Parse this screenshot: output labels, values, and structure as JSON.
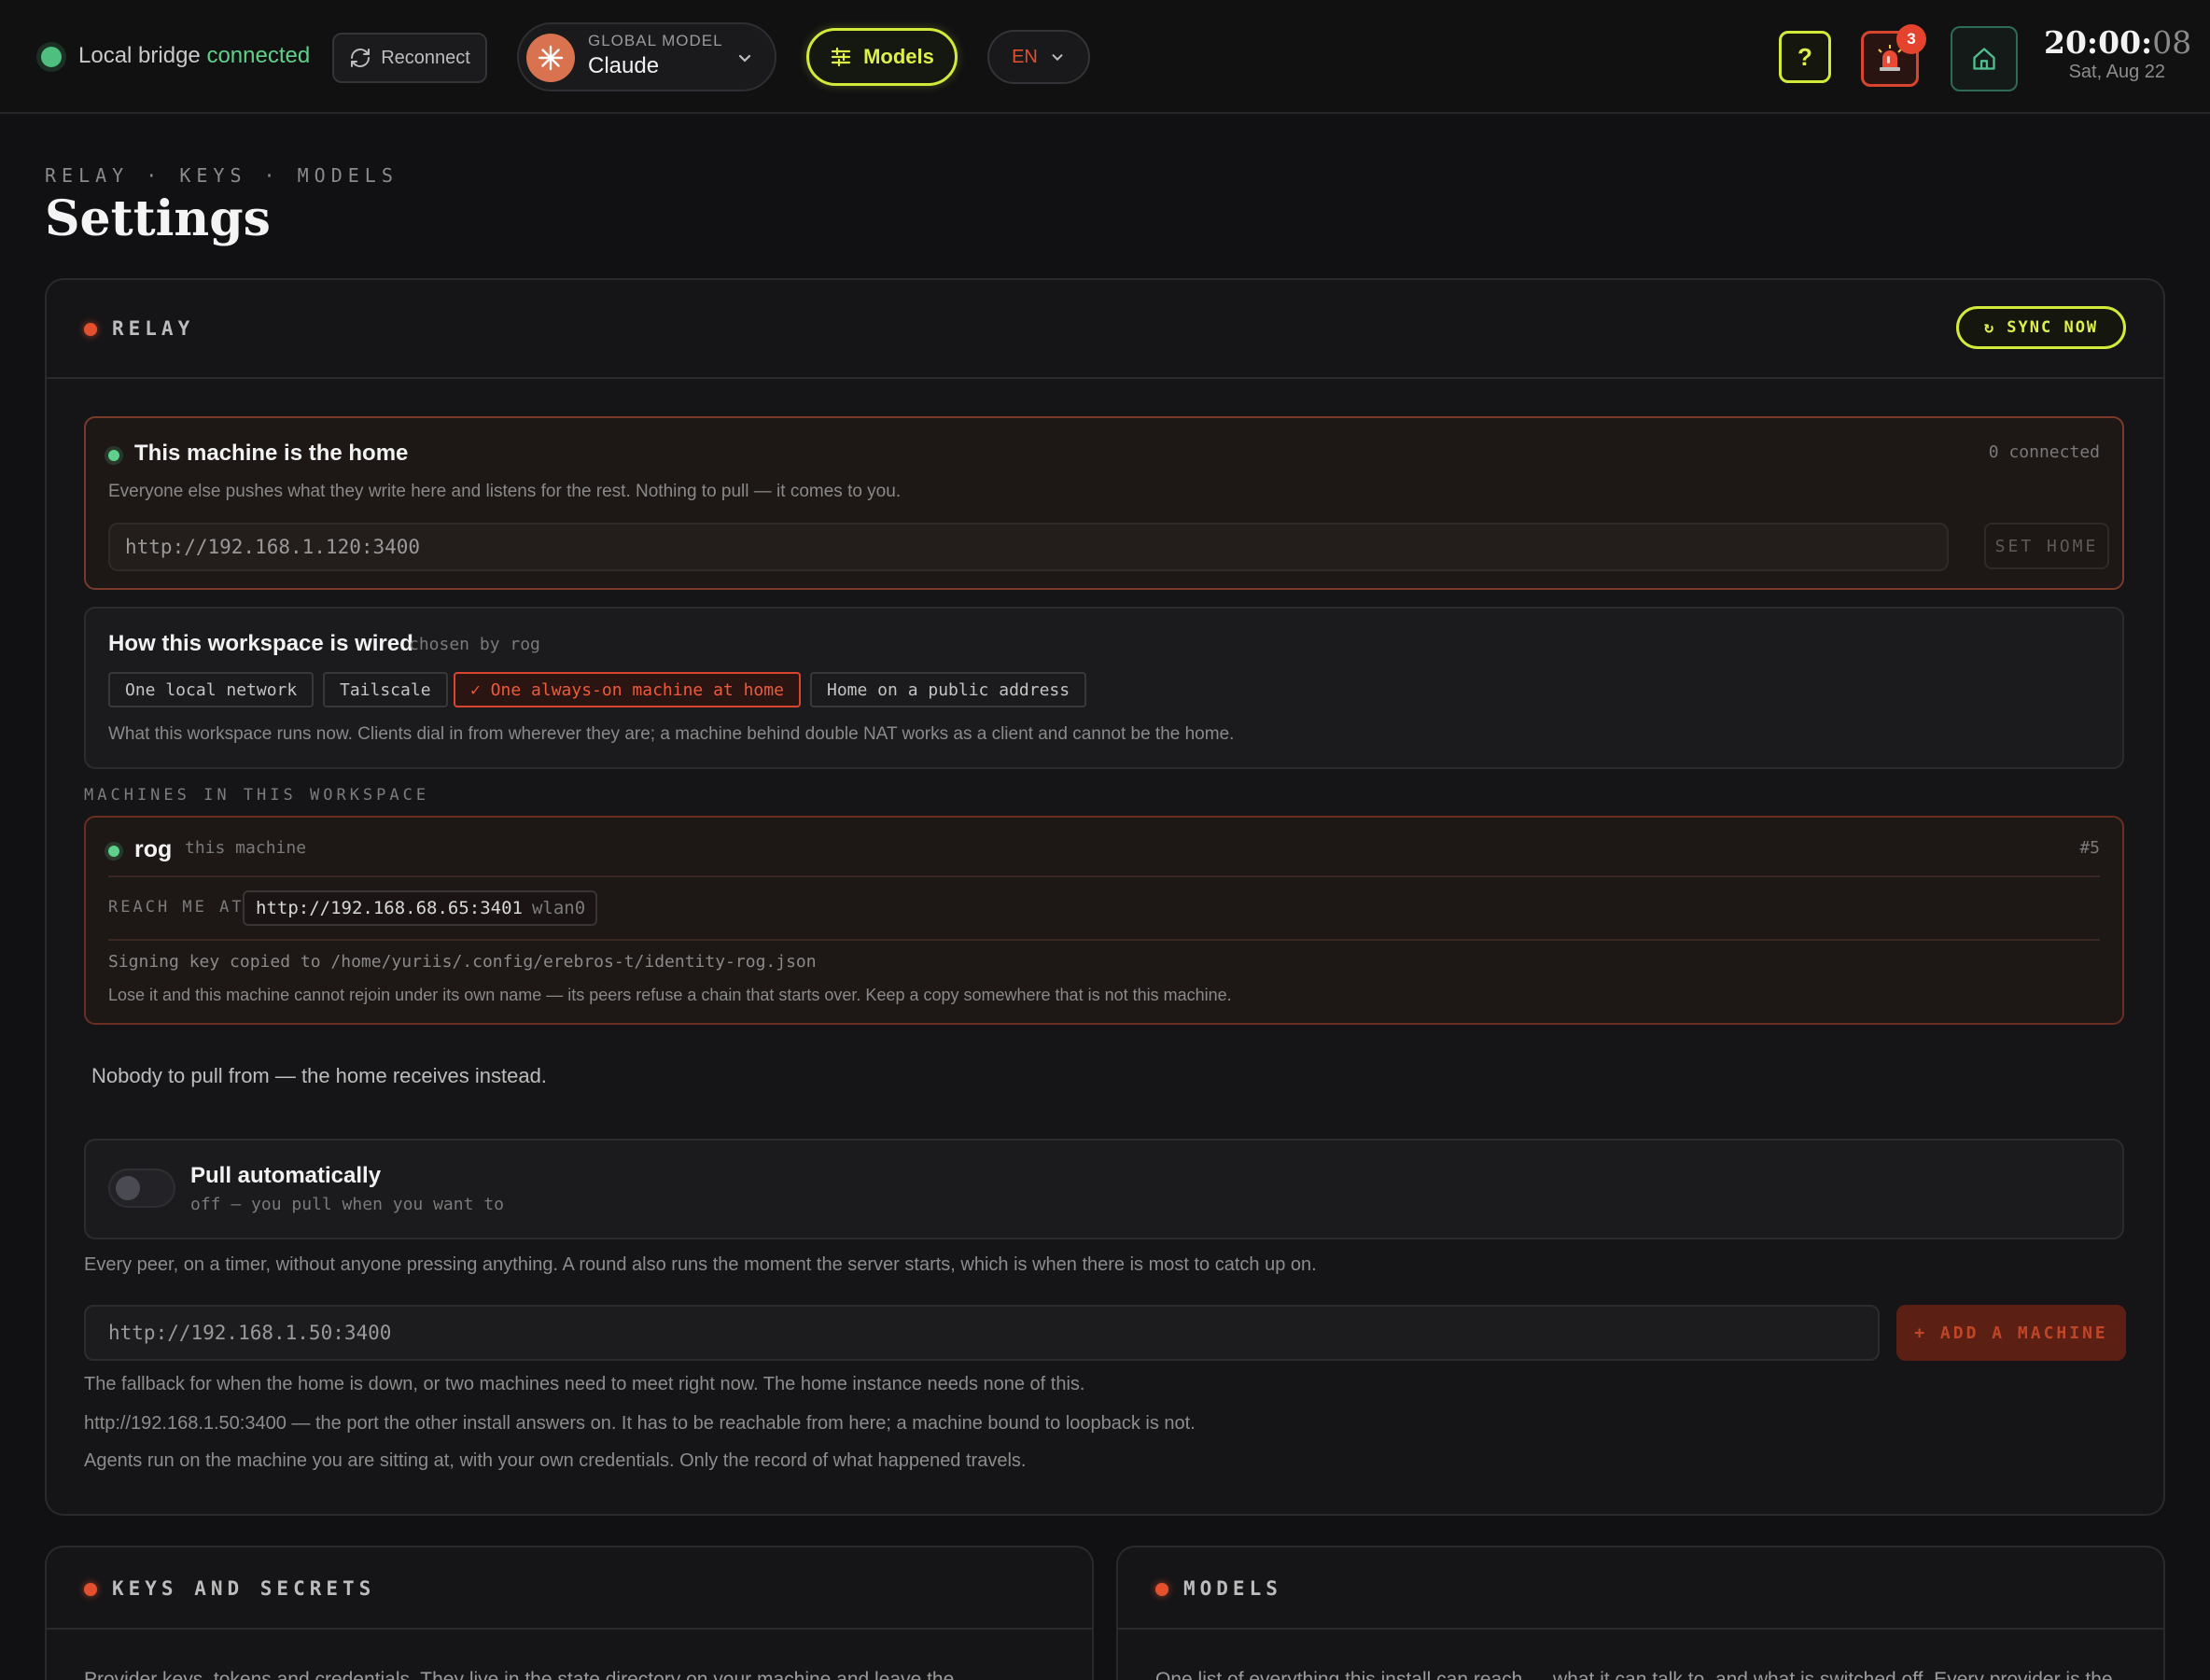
{
  "topbar": {
    "bridge_label": "Local bridge",
    "bridge_status": "connected",
    "reconnect_label": "Reconnect",
    "model_label": "GLOBAL MODEL",
    "model_name": "Claude",
    "models_label": "Models",
    "lang_label": "EN",
    "help_label": "?",
    "alarm_count": "3",
    "clock_hm": "20:00:",
    "clock_s": "08",
    "date": "Sat, Aug 22",
    "colors": {
      "accent": "#d4ea3a",
      "danger": "#e4442d",
      "ok": "#5fd08a"
    }
  },
  "page": {
    "breadcrumb": "RELAY · KEYS · MODELS",
    "title": "Settings"
  },
  "relay": {
    "title": "RELAY",
    "sync_label": "↻ SYNC NOW",
    "home_card": {
      "title": "This machine is the home",
      "connected": "0 connected",
      "description": "Everyone else pushes what they write here and listens for the rest. Nothing to pull — it comes to you.",
      "url_placeholder": "http://192.168.1.120:3400",
      "set_home_label": "SET HOME"
    },
    "wired_card": {
      "title": "How this workspace is wired",
      "chosen_by": "chosen by rog",
      "options": [
        "One local network",
        "Tailscale",
        "✓ One always-on machine at home",
        "Home on a public address"
      ],
      "selected_index": 2,
      "description": "What this workspace runs now. Clients dial in from wherever they are; a machine behind double NAT works as a client and cannot be the home."
    },
    "machines_label": "MACHINES IN THIS WORKSPACE",
    "machine": {
      "name": "rog",
      "tag": "this machine",
      "number": "#5",
      "reach_label": "REACH ME AT",
      "reach_url": "http://192.168.68.65:3401",
      "reach_iface": "wlan0",
      "key_note": "Signing key copied to /home/yuriis/.config/erebros-t/identity-rog.json",
      "key_warning": "Lose it and this machine cannot rejoin under its own name — its peers refuse a chain that starts over. Keep a copy somewhere that is not this machine."
    },
    "nobody_text": "Nobody to pull from — the home receives instead.",
    "pull": {
      "title": "Pull automatically",
      "status": "off — you pull when you want to",
      "enabled": false,
      "description": "Every peer, on a timer, without anyone pressing anything. A round also runs the moment the server starts, which is when there is most to catch up on."
    },
    "add_machine": {
      "placeholder": "http://192.168.1.50:3400",
      "button_label": "+ ADD A MACHINE",
      "note1": "The fallback for when the home is down, or two machines need to meet right now. The home instance needs none of this.",
      "note2": "http://192.168.1.50:3400 — the port the other install answers on. It has to be reachable from here; a machine bound to loopback is not.",
      "note3": "Agents run on the machine you are sitting at, with your own credentials. Only the record of what happened travels."
    }
  },
  "keys_panel": {
    "title": "KEYS AND SECRETS",
    "text": "Provider keys, tokens and credentials. They live in the state directory on your machine and leave the"
  },
  "models_panel": {
    "title": "MODELS",
    "text": "One list of everything this install can reach — what it can talk to, and what is switched off. Every provider is the"
  }
}
